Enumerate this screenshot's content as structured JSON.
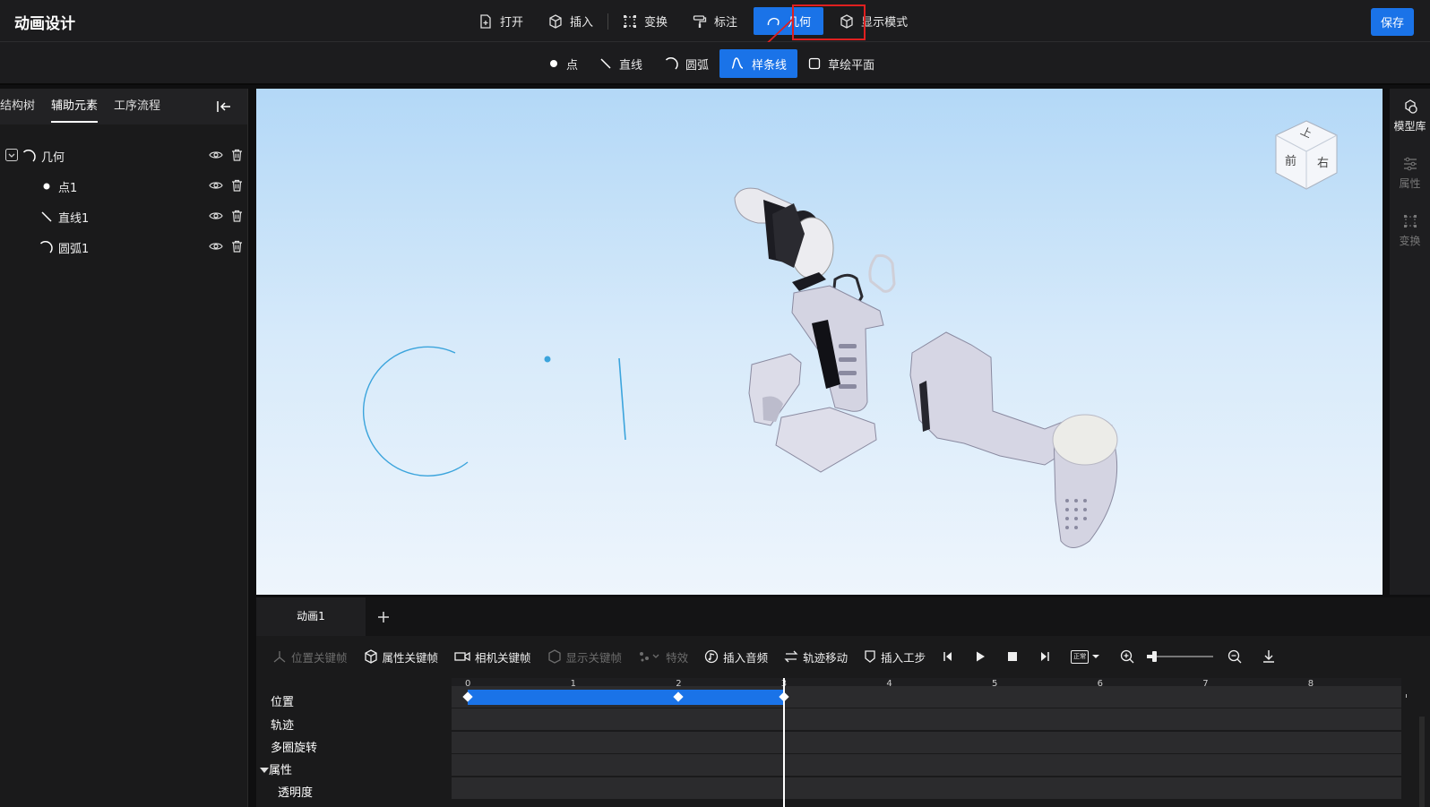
{
  "app": {
    "title": "动画设计",
    "save_label": "保存"
  },
  "top_menu": [
    {
      "label": "打开",
      "icon": "file-plus-icon"
    },
    {
      "label": "插入",
      "icon": "cube-icon"
    },
    {
      "label": "变换",
      "icon": "transform-icon"
    },
    {
      "label": "标注",
      "icon": "paint-roller-icon"
    },
    {
      "label": "几何",
      "icon": "arc-icon",
      "active": true
    },
    {
      "label": "显示模式",
      "icon": "cube-outline-icon"
    }
  ],
  "sub_menu": [
    {
      "label": "点",
      "icon": "point-icon"
    },
    {
      "label": "直线",
      "icon": "line-icon"
    },
    {
      "label": "圆弧",
      "icon": "arc-icon"
    },
    {
      "label": "样条线",
      "icon": "spline-icon",
      "active": true
    },
    {
      "label": "草绘平面",
      "icon": "plane-icon"
    }
  ],
  "left_panel": {
    "tabs": [
      "结构树",
      "辅助元素",
      "工序流程"
    ],
    "active_tab": "辅助元素",
    "tree": [
      {
        "label": "几何",
        "icon": "arc-icon",
        "level": 0
      },
      {
        "label": "点1",
        "icon": "point-icon",
        "level": 1
      },
      {
        "label": "直线1",
        "icon": "line-icon",
        "level": 1
      },
      {
        "label": "圆弧1",
        "icon": "arc-icon",
        "level": 1
      }
    ]
  },
  "view_cube": {
    "top": "上",
    "front": "前",
    "right": "右"
  },
  "right_bar": [
    {
      "label": "模型库",
      "icon": "model-library-icon"
    },
    {
      "label": "属性",
      "icon": "sliders-icon"
    },
    {
      "label": "变换",
      "icon": "transform-icon"
    }
  ],
  "timeline": {
    "tab_label": "动画1",
    "toolbar": [
      {
        "label": "位置关键帧",
        "icon": "position-keyframe-icon",
        "enabled": false
      },
      {
        "label": "属性关键帧",
        "icon": "cube-icon",
        "enabled": true
      },
      {
        "label": "相机关键帧",
        "icon": "camera-icon",
        "enabled": true
      },
      {
        "label": "显示关键帧",
        "icon": "display-keyframe-icon",
        "enabled": false
      },
      {
        "label": "特效",
        "icon": "effects-icon",
        "enabled": false
      },
      {
        "label": "插入音频",
        "icon": "audio-icon",
        "enabled": true
      },
      {
        "label": "轨迹移动",
        "icon": "path-move-icon",
        "enabled": true
      },
      {
        "label": "插入工步",
        "icon": "shield-icon",
        "enabled": true
      }
    ],
    "speed_label": "正常",
    "ruler_ticks": [
      "0",
      "1",
      "2",
      "3",
      "4",
      "5",
      "6",
      "7",
      "8"
    ],
    "track_labels": [
      "位置",
      "轨迹",
      "多圈旋转",
      "属性",
      "透明度"
    ],
    "playhead_time": 3.0,
    "zoom_level": 0.1,
    "keyframes": {
      "track": "位置",
      "times": [
        0,
        2,
        3
      ],
      "segment": [
        0,
        3
      ]
    }
  },
  "colors": {
    "accent": "#1a73e8",
    "highlight": "#e02020",
    "geometry": "#3ba4dc"
  }
}
